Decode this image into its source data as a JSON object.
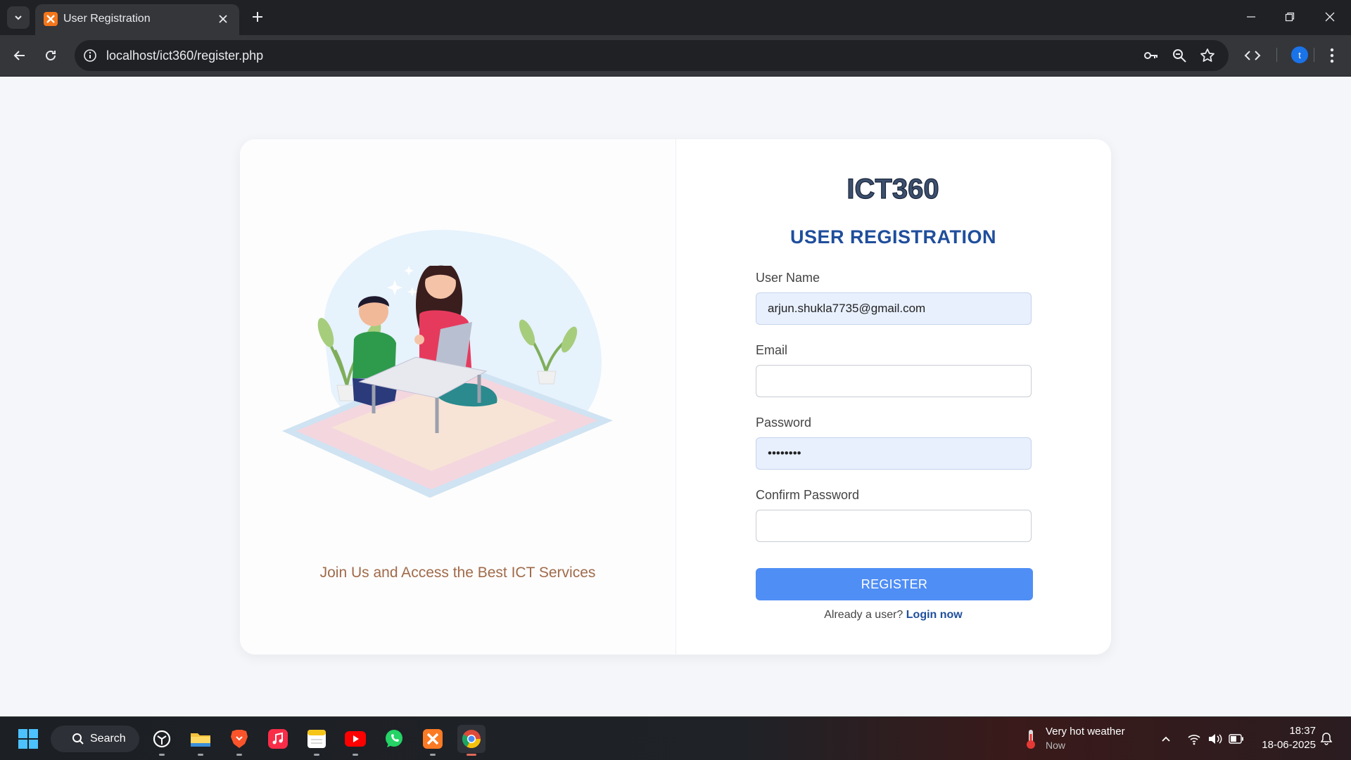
{
  "browser": {
    "tab_title": "User Registration",
    "url": "localhost/ict360/register.php",
    "profile_initial": "t"
  },
  "page": {
    "logo_text": "ICT360",
    "form_title": "USER REGISTRATION",
    "tagline": "Join Us and Access the Best ICT Services",
    "fields": {
      "username_label": "User Name",
      "username_value": "arjun.shukla7735@gmail.com",
      "email_label": "Email",
      "email_value": "",
      "password_label": "Password",
      "password_value": "••••••••",
      "confirm_label": "Confirm Password",
      "confirm_value": ""
    },
    "register_label": "REGISTER",
    "login_prompt": "Already a user?",
    "login_link": "Login now"
  },
  "taskbar": {
    "search_label": "Search",
    "weather_title": "Very hot weather",
    "weather_sub": "Now",
    "time": "18:37",
    "date": "18-06-2025",
    "apps": [
      "chatgpt-icon",
      "file-explorer-icon",
      "brave-icon",
      "music-icon",
      "notes-icon",
      "youtube-icon",
      "whatsapp-icon",
      "xampp-icon",
      "chrome-icon"
    ]
  },
  "colors": {
    "accent_button": "#4f8ef5",
    "title_blue": "#1f4e9c",
    "tagline_brown": "#a06a4a",
    "autofill_bg": "#e8f0fe"
  }
}
